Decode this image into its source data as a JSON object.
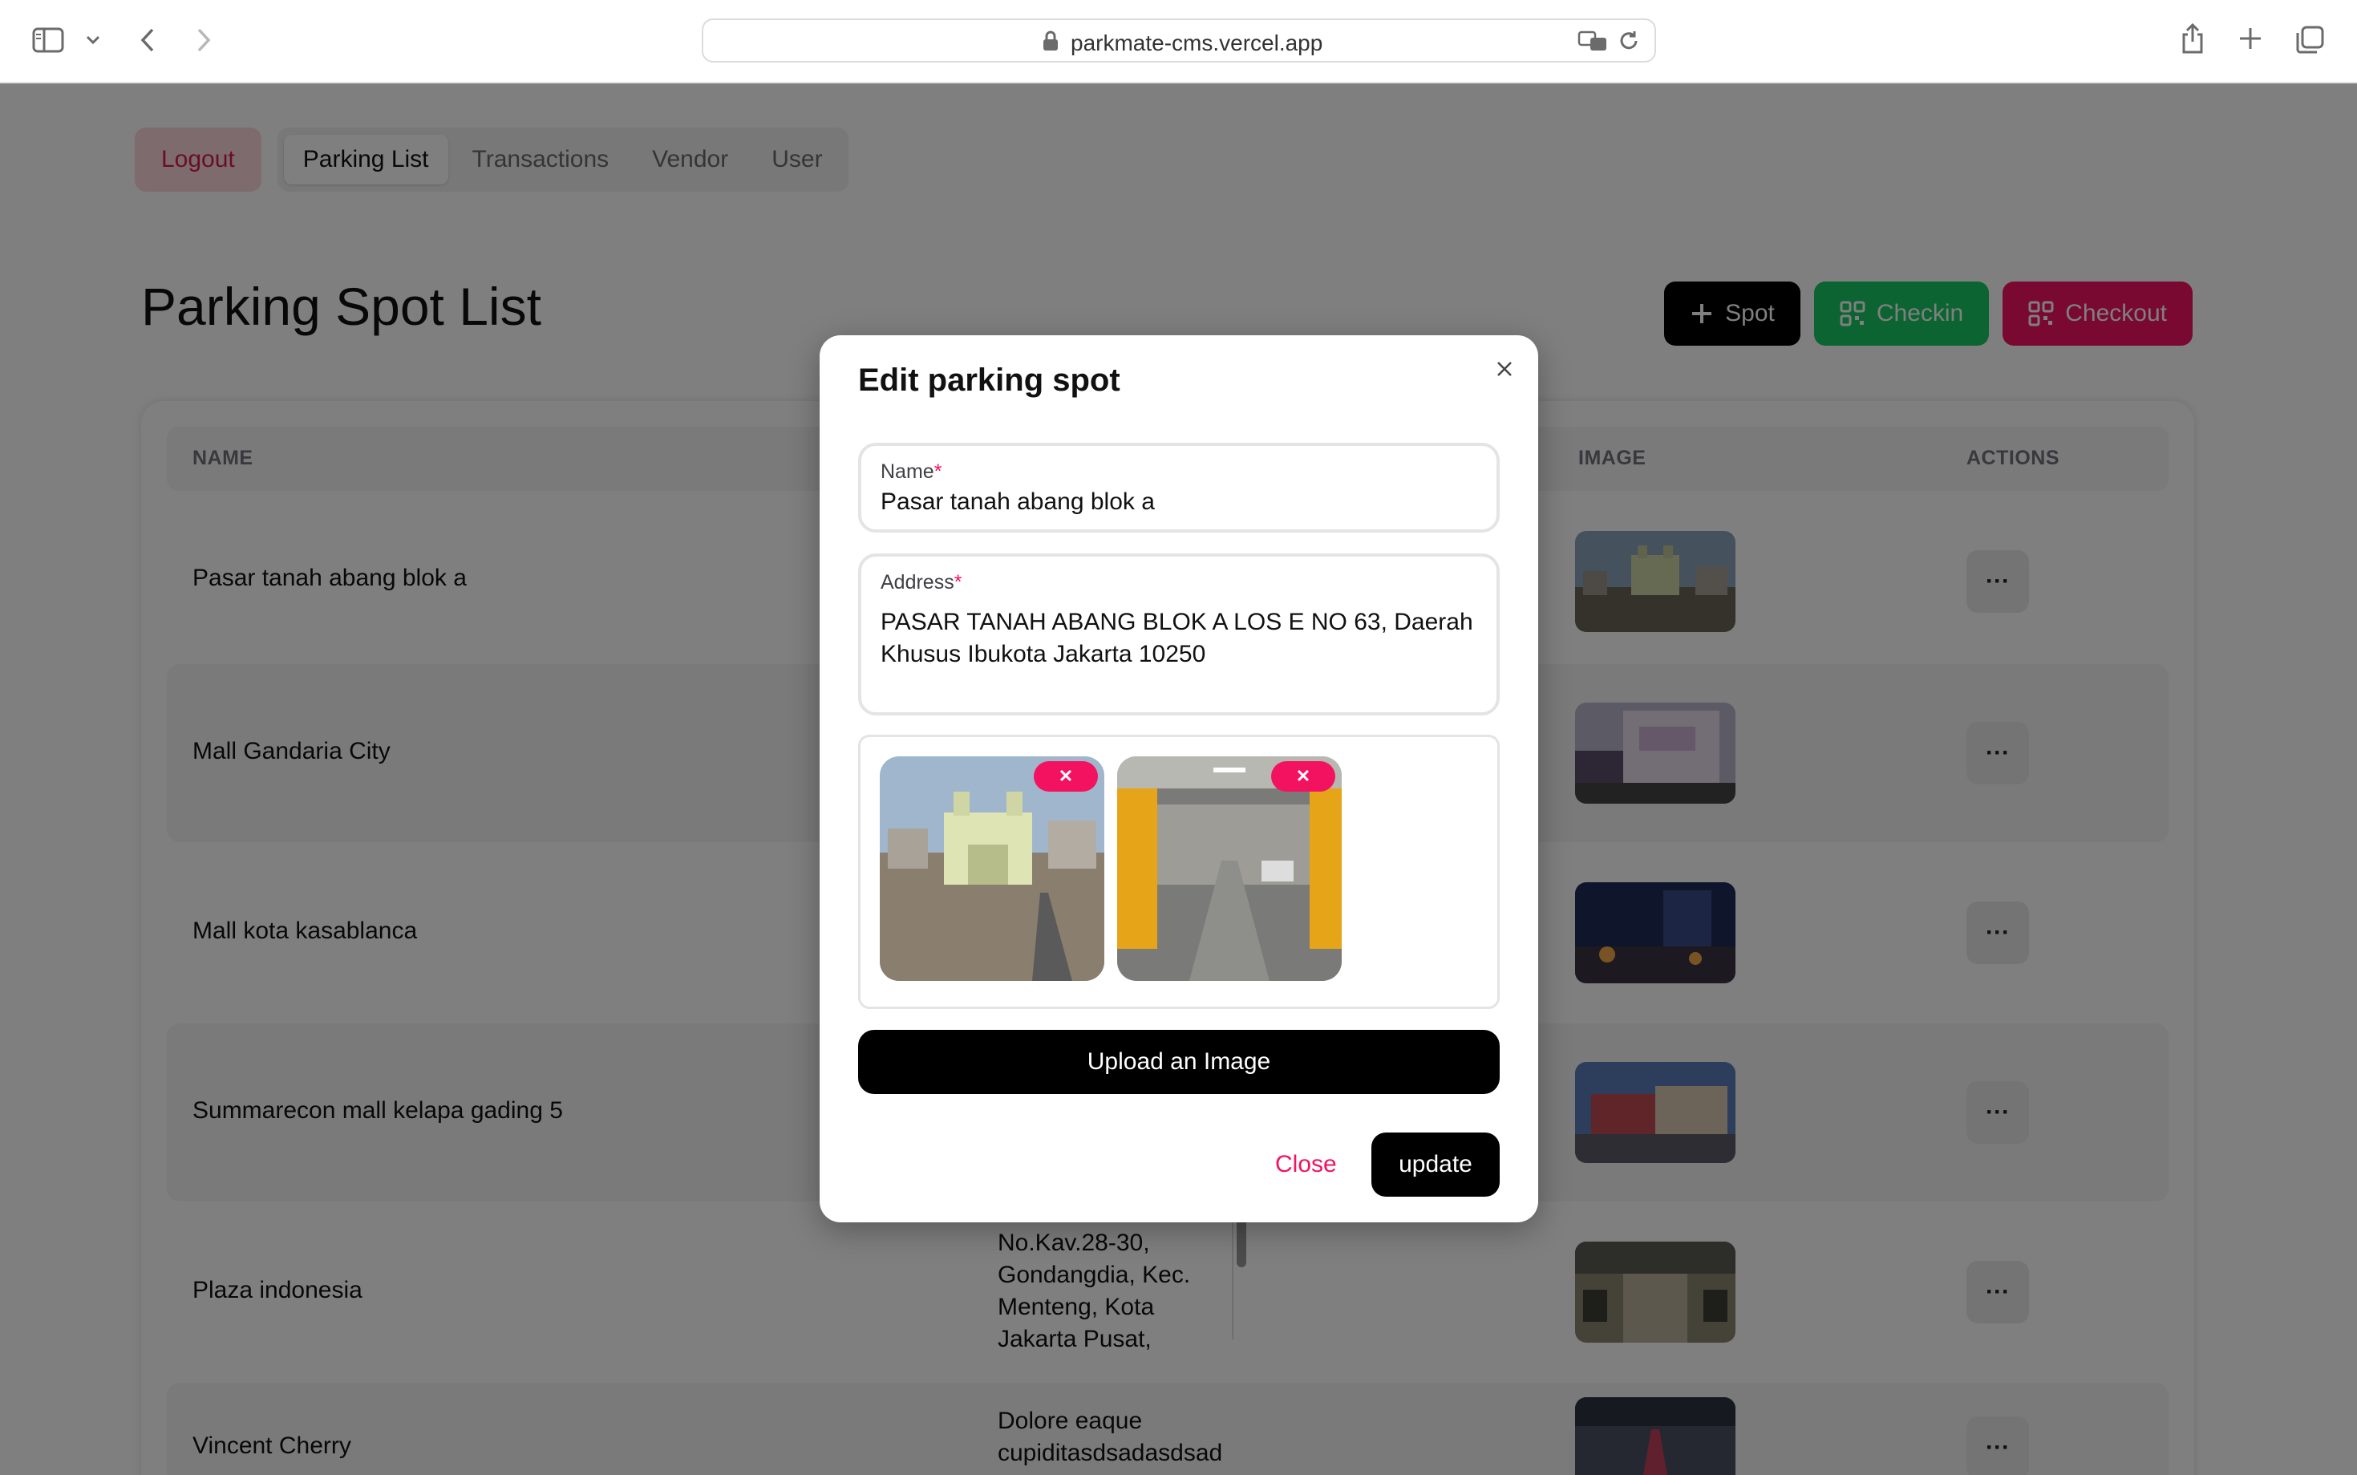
{
  "browser": {
    "url": "parkmate-cms.vercel.app"
  },
  "nav": {
    "logout_label": "Logout",
    "tabs": [
      {
        "label": "Parking List"
      },
      {
        "label": "Transactions"
      },
      {
        "label": "Vendor"
      },
      {
        "label": "User"
      }
    ]
  },
  "page": {
    "title": "Parking Spot List",
    "buttons": {
      "spot": "Spot",
      "checkin": "Checkin",
      "checkout": "Checkout"
    }
  },
  "table": {
    "headers": {
      "name": "NAME",
      "image": "IMAGE",
      "actions": "ACTIONS"
    },
    "rows": [
      {
        "name": "Pasar tanah abang blok a",
        "address": ""
      },
      {
        "name": "Mall Gandaria City",
        "address": ""
      },
      {
        "name": "Mall kota kasablanca",
        "address": ""
      },
      {
        "name": "Summarecon mall kelapa gading 5",
        "address": ""
      },
      {
        "name": "Plaza indonesia",
        "address": "Jl. M.H. Thamrin No.Kav.28-30, Gondangdia, Kec. Menteng, Kota Jakarta Pusat,"
      },
      {
        "name": "Vincent Cherry",
        "address": "Dolore eaque cupiditasdsadasdsad"
      }
    ],
    "action_icon": "···"
  },
  "modal": {
    "title": "Edit parking spot",
    "name_field": {
      "label": "Name",
      "required_mark": "*",
      "value": "Pasar tanah abang blok a"
    },
    "address_field": {
      "label": "Address",
      "required_mark": "*",
      "value_line1": "PASAR TANAH ABANG BLOK A LOS E NO 63, Daerah",
      "value_line2": "Khusus Ibukota Jakarta 10250"
    },
    "remove_icon": "✕",
    "upload_label": "Upload an Image",
    "close_label": "Close",
    "update_label": "update"
  },
  "colors": {
    "danger": "#f31260",
    "success": "#17c964",
    "primary_black": "#000000"
  }
}
